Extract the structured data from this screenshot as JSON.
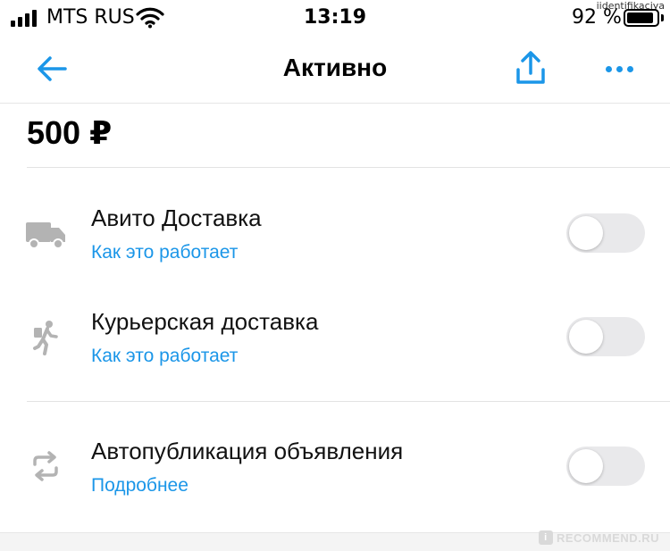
{
  "watermark_top": "iidentifikaciya",
  "status_bar": {
    "carrier": "MTS RUS",
    "time": "13:19",
    "battery_percent": "92 %",
    "battery_level": 0.92
  },
  "nav": {
    "title": "Активно"
  },
  "listing": {
    "price": "500 ₽"
  },
  "options": [
    {
      "title": "Авито Доставка",
      "link": "Как это работает",
      "enabled": false,
      "icon": "truck-icon"
    },
    {
      "title": "Курьерская доставка",
      "link": "Как это работает",
      "enabled": false,
      "icon": "courier-icon"
    },
    {
      "title": "Автопубликация объявления",
      "link": "Подробнее",
      "enabled": false,
      "icon": "repeat-icon"
    }
  ],
  "colors": {
    "accent": "#1b96e8",
    "toggle_off": "#e9e9eb",
    "icon_gray": "#b3b3b3"
  },
  "watermark_bottom": "RECOMMEND.RU"
}
